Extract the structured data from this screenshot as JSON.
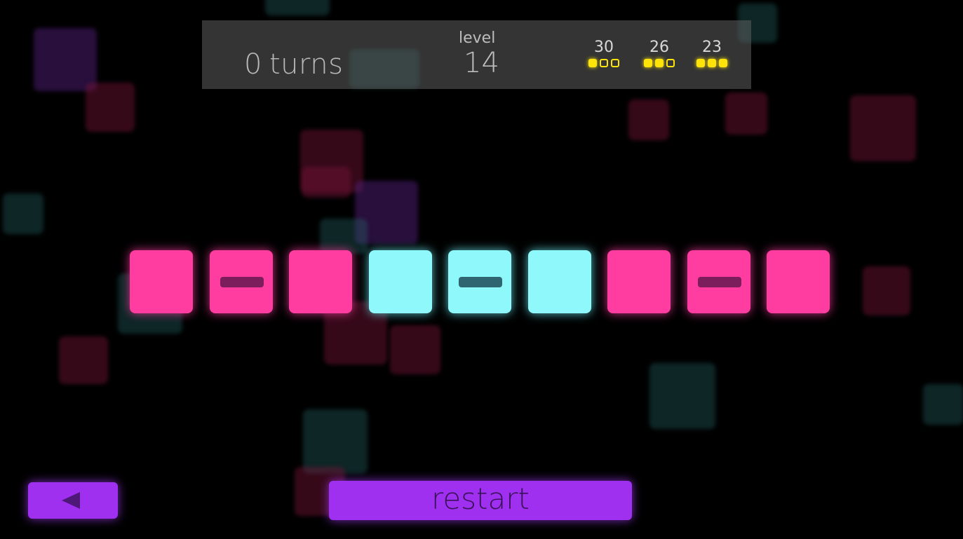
{
  "hud": {
    "turns_value": "0",
    "turns_label": "turns",
    "level_label": "level",
    "level_value": "14",
    "star_targets": [
      {
        "target": "30",
        "filled": 1,
        "total": 3
      },
      {
        "target": "26",
        "filled": 2,
        "total": 3
      },
      {
        "target": "23",
        "filled": 3,
        "total": 3
      }
    ]
  },
  "tiles": [
    {
      "color": "pink",
      "has_bar": false
    },
    {
      "color": "pink",
      "has_bar": true
    },
    {
      "color": "pink",
      "has_bar": false
    },
    {
      "color": "cyan",
      "has_bar": false
    },
    {
      "color": "cyan",
      "has_bar": true
    },
    {
      "color": "cyan",
      "has_bar": false
    },
    {
      "color": "pink",
      "has_bar": false
    },
    {
      "color": "pink",
      "has_bar": true
    },
    {
      "color": "pink",
      "has_bar": false
    }
  ],
  "buttons": {
    "back_icon": "back-arrow-icon",
    "restart_label": "restart"
  },
  "colors": {
    "pink_tile": "#ff3da0",
    "cyan_tile": "#8ef8fa",
    "button": "#a030f0",
    "star_pip": "#ffe40a"
  }
}
